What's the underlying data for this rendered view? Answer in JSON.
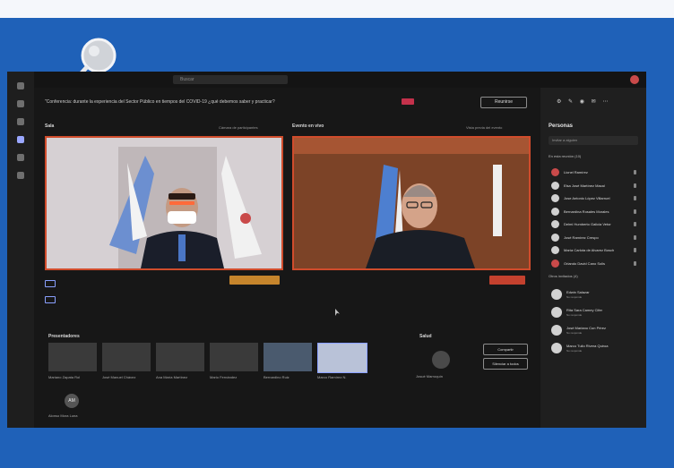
{
  "app": {
    "search_placeholder": "Buscar"
  },
  "meeting": {
    "title": "\"Conferencia: durante la experiencia del Sector Público en tiempos del COVID-19 ¿qué debemos saber y practicar?",
    "join_label": "Reunirse"
  },
  "stage": {
    "left_label": "Sala",
    "left_sub": "Cámara de participantes",
    "right_label": "Evento en vivo",
    "right_sub": "Vista previa del evento"
  },
  "presenters": {
    "label": "Presentadores",
    "thumbs": [
      {
        "label": "Mariano Zapata Rol"
      },
      {
        "label": "José Manuel Chávez"
      },
      {
        "label": "Ana María Martínez"
      },
      {
        "label": "Mario Fernández"
      },
      {
        "label": "Bernardino Ruiz"
      },
      {
        "label": "Marco Ramírez N."
      }
    ],
    "bottom_avatar_initials": "AM",
    "bottom_avatar_label": "Alonso Mora Luna"
  },
  "guests": {
    "label": "Salud",
    "person_label": "Josué Marroquín",
    "button1": "Compartir",
    "button2": "Silenciar a todos"
  },
  "panel": {
    "title": "Personas",
    "invite_placeholder": "Invitar a alguien",
    "section_in_meeting": "En esta reunión (10)",
    "section_others": "Otros invitados (4)",
    "people": [
      {
        "name": "Lionel Ramírez"
      },
      {
        "name": "Elsa José Martínez Macal"
      },
      {
        "name": "Jose Antonio López Villarruel"
      },
      {
        "name": "Bernardina Rosales Morales"
      },
      {
        "name": "Delmi Humberto Galicia Vetor"
      },
      {
        "name": "José Ramírez Crespo"
      },
      {
        "name": "María Carlota de Alvarez Bosch"
      },
      {
        "name": "Orlando David Cano Solis"
      }
    ],
    "others": [
      {
        "name": "Edwin Salazar",
        "sub": "No responde"
      },
      {
        "name": "Rita Sara Camey Cifer",
        "sub": "No responde"
      },
      {
        "name": "José Mariano Cun Pérez",
        "sub": "No responde"
      },
      {
        "name": "Marco Tulio Rivera Quiroa",
        "sub": "No responde"
      }
    ]
  },
  "colors": {
    "background": "#1f61b8",
    "accent_video_border": "#d04c2c",
    "teams_purple": "#8aa0ff"
  }
}
